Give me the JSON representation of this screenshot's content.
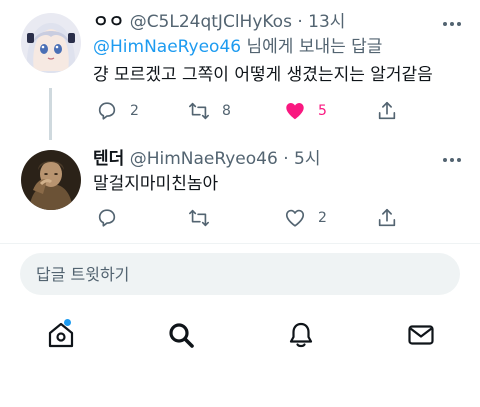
{
  "tweet1": {
    "display_name": "ㅇㅇ",
    "handle": "@C5L24qtJClHyKos",
    "separator": "·",
    "time": "13시",
    "reply_mention": "@HimNaeRyeo46",
    "reply_suffix": " 님에게 보내는 답글",
    "text": "걍 모르겠고 그쪽이 어떻게 생겼는지는 알거같음",
    "avatar_icon": "anime-girl-avatar",
    "actions": {
      "reply_count": "2",
      "retweet_count": "8",
      "like_count": "5",
      "liked": true
    }
  },
  "tweet2": {
    "display_name": "텐더",
    "handle": "@HimNaeRyeo46",
    "separator": "·",
    "time": "5시",
    "text": "말걸지마미친놈아",
    "avatar_icon": "painting-portrait-avatar",
    "actions": {
      "reply_count": "",
      "retweet_count": "",
      "like_count": "2",
      "liked": false
    }
  },
  "reply_box": {
    "placeholder": "답글 트윗하기"
  },
  "tabbar": {
    "items": [
      "home-icon",
      "search-icon",
      "notifications-icon",
      "messages-icon"
    ],
    "home_has_notification": true
  },
  "colors": {
    "accent": "#1d9bf0",
    "like": "#f91880",
    "secondary_text": "#536471"
  }
}
